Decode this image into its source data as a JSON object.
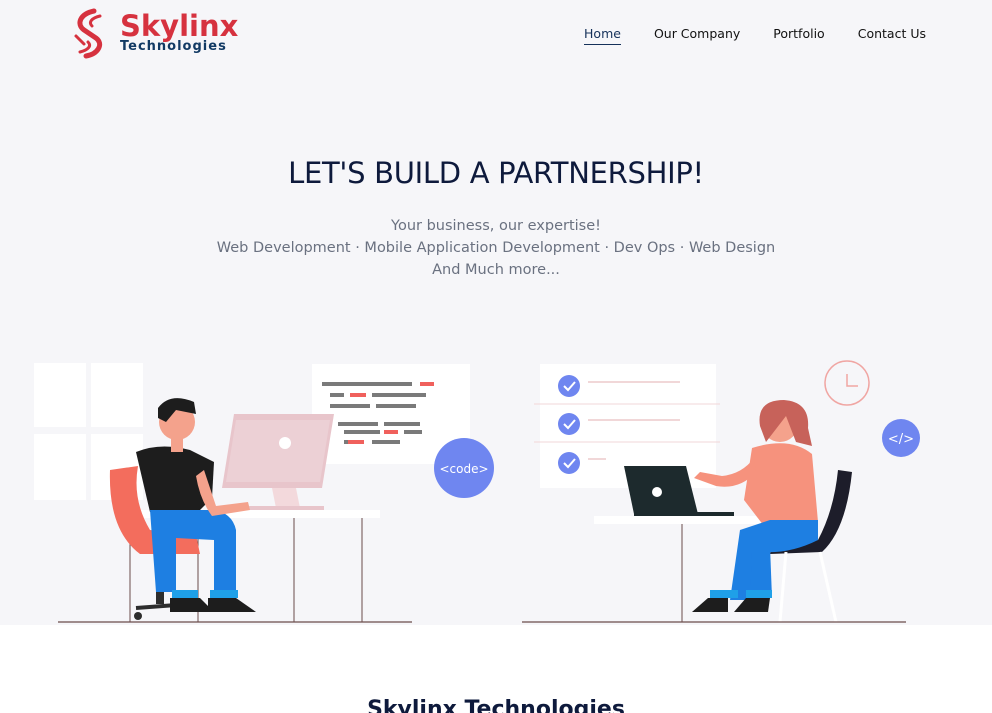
{
  "brand": {
    "name": "Skylinx",
    "subtitle": "Technologies",
    "primary_color": "#d6323f",
    "secondary_color": "#123a64"
  },
  "nav": {
    "items": [
      {
        "label": "Home",
        "active": true
      },
      {
        "label": "Our Company",
        "active": false
      },
      {
        "label": "Portfolio",
        "active": false
      },
      {
        "label": "Contact Us",
        "active": false
      }
    ]
  },
  "hero": {
    "headline": "LET'S BUILD A PARTNERSHIP!",
    "tagline_1": "Your business, our expertise!",
    "tagline_2": "Web Development · Mobile Application Development · Dev Ops · Web Design",
    "tagline_3": "And Much more...",
    "background": "#f6f6f9"
  },
  "illustration": {
    "code_bubble": "<code>",
    "tag_bubble": "</>",
    "accent_color": "#6f86f0"
  },
  "next_section": {
    "title": "Skylinx Technologies"
  }
}
